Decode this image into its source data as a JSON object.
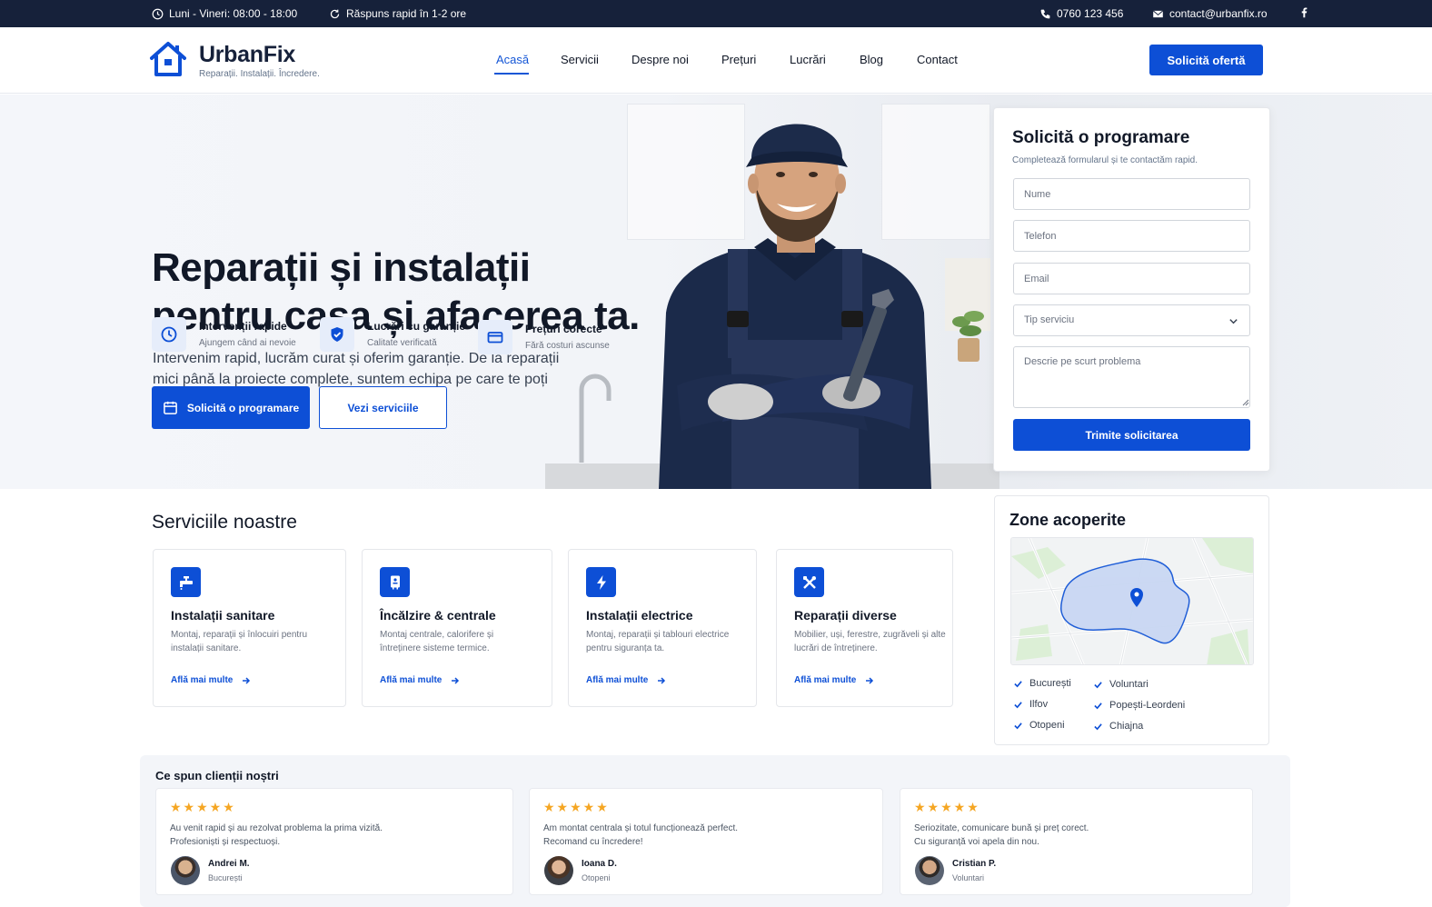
{
  "topbar": {
    "hours": "Luni - Vineri: 08:00 - 18:00",
    "response": "Răspuns rapid în 1-2 ore",
    "phone": "0760 123 456",
    "email": "contact@urbanfix.ro"
  },
  "brand": {
    "name": "UrbanFix",
    "tagline": "Reparații. Instalații. Încredere.",
    "accent": "#0d4fd6",
    "dark": "#16213a"
  },
  "nav": {
    "items": [
      {
        "label": "Acasă",
        "active": true
      },
      {
        "label": "Servicii"
      },
      {
        "label": "Despre noi"
      },
      {
        "label": "Prețuri"
      },
      {
        "label": "Lucrări"
      },
      {
        "label": "Blog"
      },
      {
        "label": "Contact"
      }
    ],
    "cta": "Solicită ofertă"
  },
  "hero": {
    "title_line1": "Reparații și instalații",
    "title_line2": "pentru casa și afacerea ta.",
    "subtitle": "Intervenim rapid, lucrăm curat și oferim garanție. De la reparații mici până la proiecte complete, suntem echipa pe care te poți baza.",
    "features": [
      {
        "icon": "clock-icon",
        "title": "Intervenții rapide",
        "desc": "Ajungem când ai nevoie"
      },
      {
        "icon": "shield-check-icon",
        "title": "Lucrări cu garanție",
        "desc": "Calitate verificată"
      },
      {
        "icon": "credit-card-icon",
        "title": "Prețuri corecte",
        "desc": "Fără costuri ascunse"
      }
    ],
    "primary_button": "Solicită o programare",
    "secondary_button": "Vezi serviciile"
  },
  "form": {
    "title": "Solicită o programare",
    "subtitle": "Completează formularul și te contactăm rapid.",
    "name_placeholder": "Nume",
    "phone_placeholder": "Telefon",
    "email_placeholder": "Email",
    "service_select": "Tip serviciu",
    "message_placeholder": "Descrie pe scurt problema",
    "submit": "Trimite solicitarea"
  },
  "services": {
    "title": "Serviciile noastre",
    "link_label": "Află mai multe",
    "items": [
      {
        "icon": "faucet-icon",
        "title": "Instalații sanitare",
        "desc": "Montaj, reparații și înlocuiri pentru instalații sanitare."
      },
      {
        "icon": "boiler-icon",
        "title": "Încălzire & centrale",
        "desc": "Montaj centrale, calorifere și întreținere sisteme termice."
      },
      {
        "icon": "lightning-icon",
        "title": "Instalații electrice",
        "desc": "Montaj, reparații și tablouri electrice pentru siguranța ta."
      },
      {
        "icon": "tools-icon",
        "title": "Reparații diverse",
        "desc": "Mobilier, uși, ferestre, zugrăveli și alte lucrări de întreținere."
      }
    ]
  },
  "zones": {
    "title": "Zone acoperite",
    "left": [
      "București",
      "Ilfov",
      "Otopeni"
    ],
    "right": [
      "Voluntari",
      "Popești-Leordeni",
      "Chiajna"
    ]
  },
  "reviews": {
    "title": "Ce spun clienții noștri",
    "stars": "★★★★★",
    "items": [
      {
        "line1": "Au venit rapid și au rezolvat problema la prima vizită.",
        "line2": "Profesioniști și respectuoși.",
        "name": "Andrei M.",
        "location": "București",
        "rating": 5
      },
      {
        "line1": "Am montat centrala și totul funcționează perfect.",
        "line2": "Recomand cu încredere!",
        "name": "Ioana D.",
        "location": "Otopeni",
        "rating": 5
      },
      {
        "line1": "Seriozitate, comunicare bună și preț corect.",
        "line2": "Cu siguranță voi apela din nou.",
        "name": "Cristian P.",
        "location": "Voluntari",
        "rating": 5
      }
    ]
  }
}
